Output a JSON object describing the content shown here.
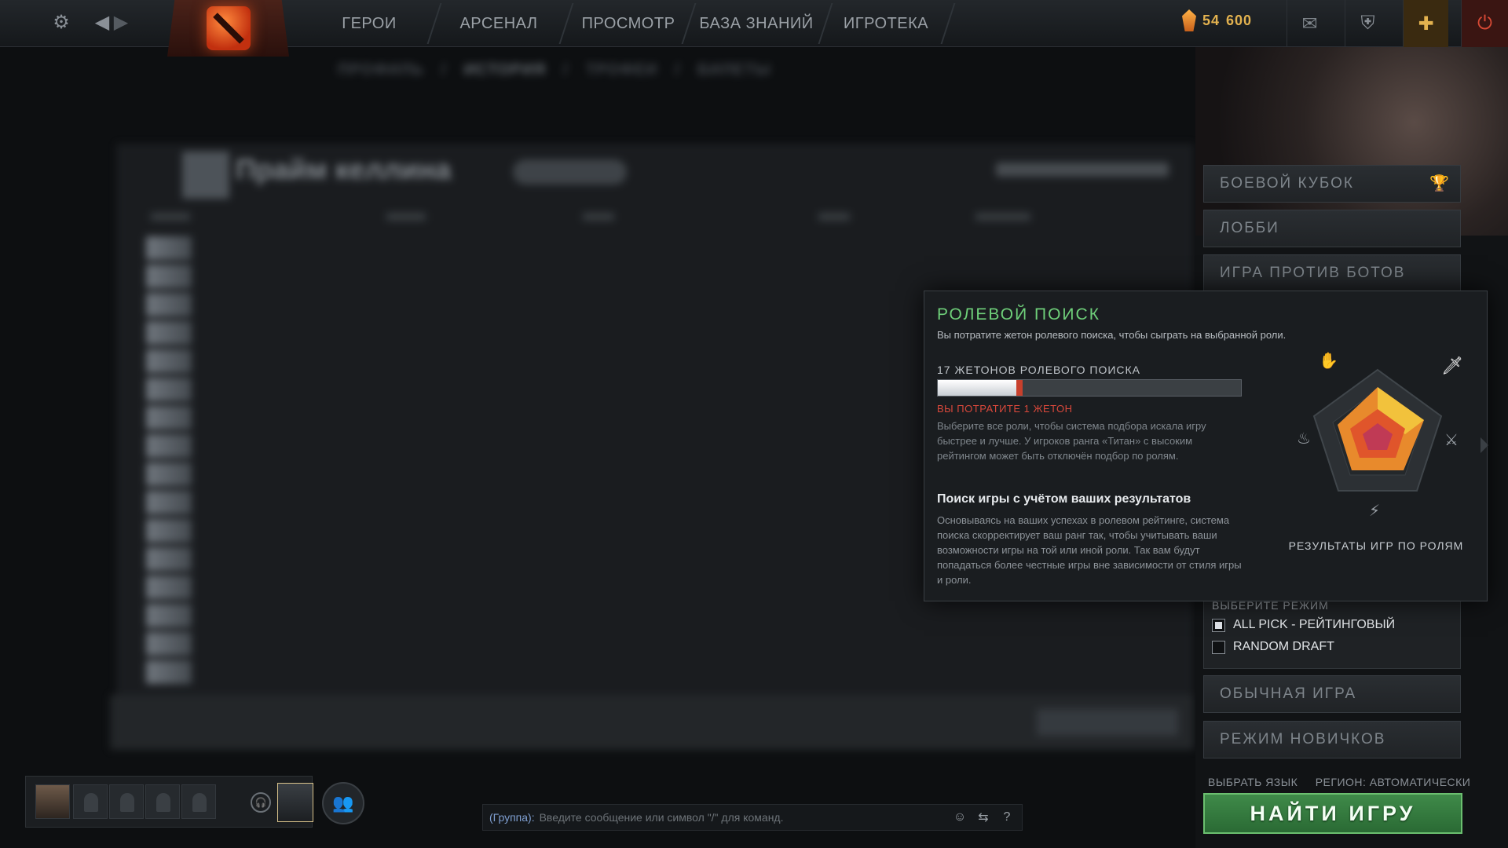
{
  "nav": {
    "items": [
      "ГЕРОИ",
      "АРСЕНАЛ",
      "ПРОСМОТР",
      "БАЗА ЗНАНИЙ",
      "ИГРОТЕКА"
    ],
    "currency": {
      "shards": "54",
      "extra": "600"
    }
  },
  "background": {
    "breadcrumbs": [
      "ПРОФИЛЬ",
      "ИСТОРИЯ",
      "ТРОФЕИ",
      "БИЛЕТЫ"
    ],
    "title": "Прайм келлина"
  },
  "play_panel": {
    "battle_cup": "БОЕВОЙ КУБОК",
    "lobby": "ЛОББИ",
    "bots": "ИГРА ПРОТИВ БОТОВ",
    "mode_header": "ВЫБЕРИТЕ РЕЖИМ",
    "modes": [
      {
        "label": "ALL PICK - РЕЙТИНГОВЫЙ",
        "checked": true
      },
      {
        "label": "RANDOM DRAFT",
        "checked": false
      }
    ],
    "normal": "ОБЫЧНАЯ ИГРА",
    "newbie": "РЕЖИМ НОВИЧКОВ",
    "lang": "ВЫБРАТЬ ЯЗЫК",
    "region": "РЕГИОН: АВТОМАТИЧЕСКИ",
    "find": "НАЙТИ ИГРУ"
  },
  "role_popup": {
    "title": "РОЛЕВОЙ ПОИСК",
    "subtitle": "Вы потратите жетон ролевого поиска, чтобы сыграть на выбранной роли.",
    "tokens": "17 ЖЕТОНОВ РОЛЕВОГО ПОИСКА",
    "token_fill": 0.27,
    "spend": "ВЫ ПОТРАТИТЕ 1 ЖЕТОН",
    "desc": "Выберите все роли, чтобы система подбора искала игру быстрее и лучше. У игроков ранга «Титан» с высоким рейтингом может быть отключён подбор по ролям.",
    "h2": "Поиск игры с учётом ваших результатов",
    "desc2": "Основываясь на ваших успехах в ролевом рейтинге, система поиска скорректирует ваш ранг так, чтобы учитывать ваши возможности игры на той или иной роли. Так вам будут попадаться более честные игры вне зависимости от стиля игры и роли.",
    "radar_label": "РЕЗУЛЬТАТЫ ИГР ПО РОЛЯМ"
  },
  "chat": {
    "channel": "(Группа):",
    "placeholder": "Введите сообщение или символ \"/\" для команд.",
    "help": "?"
  },
  "colors": {
    "accent_green": "#6fd07a",
    "warn_red": "#d9483b",
    "find_button": "#3f8a49",
    "gold": "#e3b24f"
  },
  "icons": [
    "gear-icon",
    "back-arrow-icon",
    "forward-arrow-icon",
    "shard-icon",
    "mail-icon",
    "armory-icon",
    "plus-icon",
    "power-icon",
    "trophy-icon",
    "headset-icon",
    "group-icon",
    "smiley-icon",
    "translate-icon"
  ]
}
